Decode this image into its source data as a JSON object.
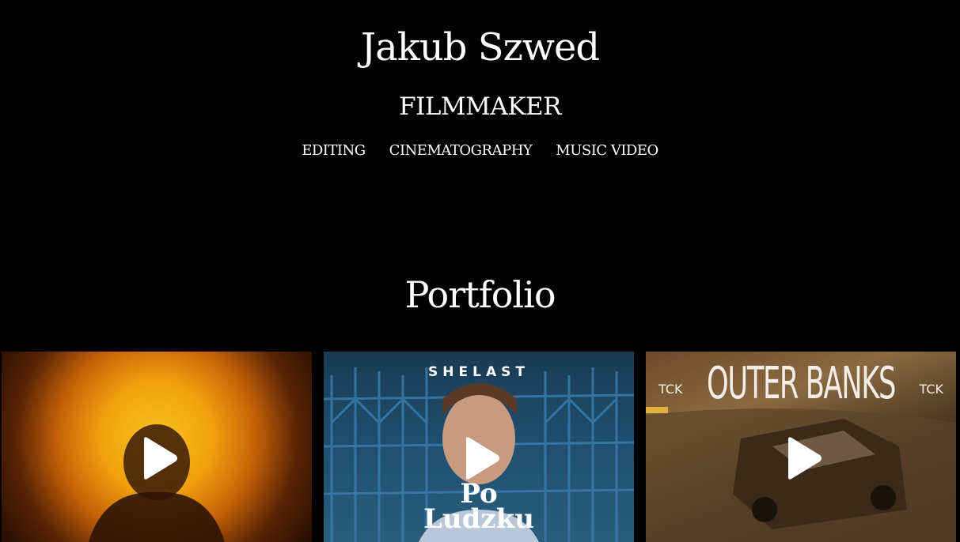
{
  "header": {
    "title": "Jakub Szwed",
    "subtitle": "FILMMAKER"
  },
  "nav": {
    "items": [
      {
        "label": "EDITING"
      },
      {
        "label": "CINEMATOGRAPHY"
      },
      {
        "label": "MUSIC VIDEO"
      }
    ]
  },
  "portfolio": {
    "title": "Portfolio",
    "videos": [
      {
        "thumbnail_text_top": "",
        "thumbnail_text_bottom": "",
        "icon": "play-icon"
      },
      {
        "thumbnail_text_top": "SHELAST",
        "thumbnail_text_bottom": "Po Ludzku",
        "icon": "play-icon"
      },
      {
        "thumbnail_text_top": "OUTER BANKS",
        "thumbnail_tag_left": "TCK",
        "thumbnail_tag_right": "TCK",
        "icon": "play-icon"
      }
    ]
  },
  "colors": {
    "background": "#000000",
    "text": "#ffffff"
  }
}
